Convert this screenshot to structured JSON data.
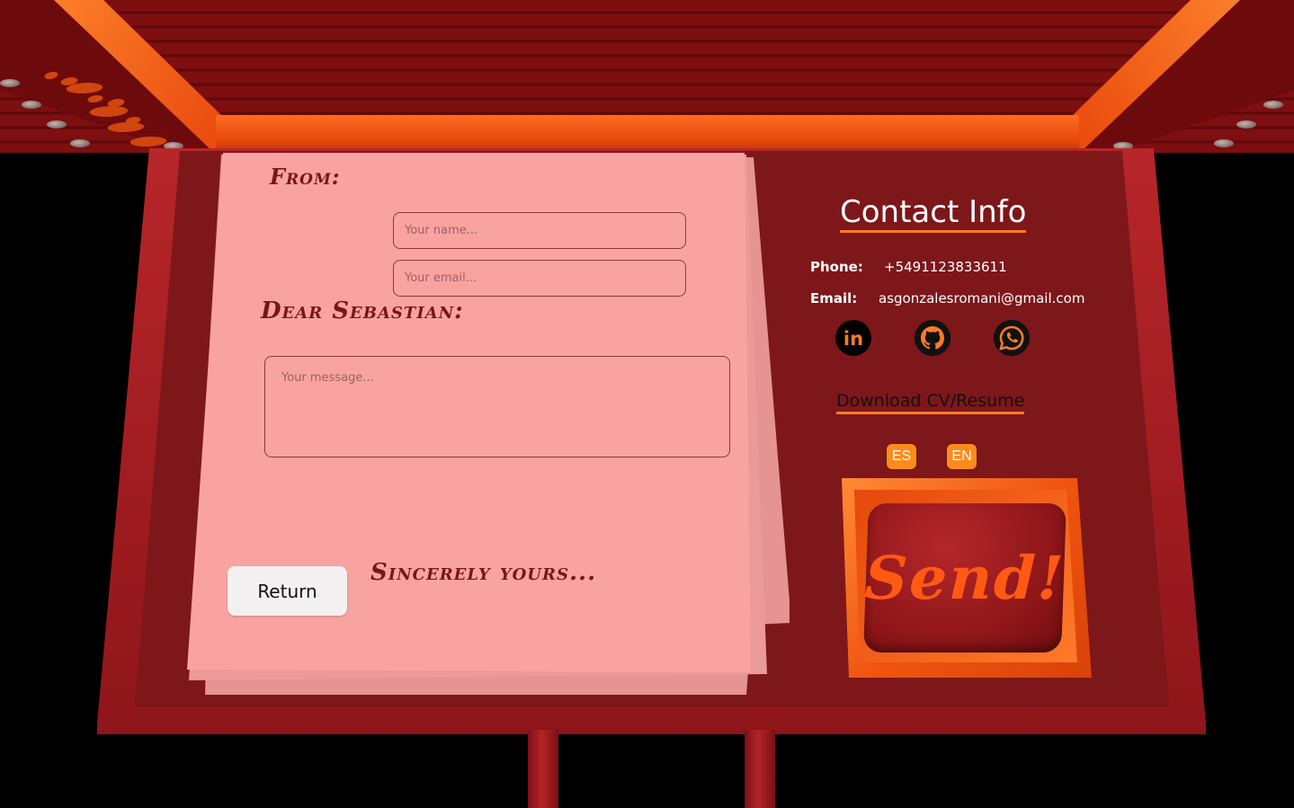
{
  "letter": {
    "from_label": "From:",
    "name_placeholder": "Your name...",
    "email_placeholder": "Your email...",
    "greeting": "Dear Sebastian:",
    "message_placeholder": "Your message...",
    "closing": "Sincerely yours...",
    "return_label": "Return"
  },
  "contact": {
    "title": "Contact Info",
    "phone_label": "Phone:",
    "phone_value": "+5491123833611",
    "email_label": "Email:",
    "email_value": "asgonzalesromani@gmail.com",
    "socials": [
      {
        "icon": "linkedin-icon"
      },
      {
        "icon": "github-icon"
      },
      {
        "icon": "whatsapp-icon"
      }
    ],
    "cv_link": "Download CV/Resume",
    "lang_es": "ES",
    "lang_en": "EN",
    "send_label": "Send!"
  },
  "colors": {
    "accent": "#ff7b23",
    "board": "#7d171a",
    "paper": "#f9a3a1",
    "send_text": "#ff5a14"
  }
}
